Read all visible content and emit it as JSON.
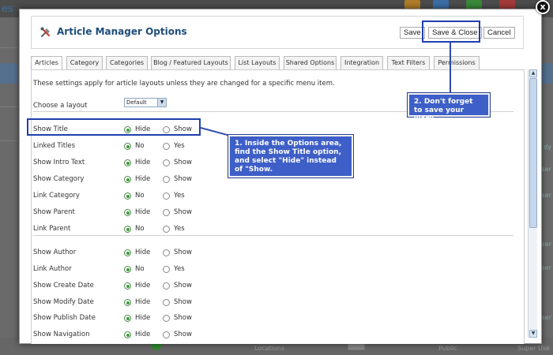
{
  "background": {
    "partial_word": "es",
    "right_text": [
      "dy",
      "ser",
      "ser",
      "ser",
      "ser",
      "ser"
    ],
    "bottom_texts": [
      "Locations",
      "0",
      "Public",
      "Super Use"
    ]
  },
  "modal": {
    "title": "Article Manager Options",
    "close_glyph": "x",
    "toolbar": {
      "save_label": "Save",
      "save_close_label": "Save & Close",
      "cancel_label": "Cancel"
    },
    "tabs": [
      {
        "label": "Articles",
        "active": true
      },
      {
        "label": "Category",
        "active": false
      },
      {
        "label": "Categories",
        "active": false
      },
      {
        "label": "Blog / Featured Layouts",
        "active": false
      },
      {
        "label": "List Layouts",
        "active": false
      },
      {
        "label": "Shared Options",
        "active": false
      },
      {
        "label": "Integration",
        "active": false
      },
      {
        "label": "Text Filters",
        "active": false
      },
      {
        "label": "Permissions",
        "active": false
      }
    ],
    "intro_text": "These settings apply for article layouts unless they are changed for a specific menu item.",
    "layout": {
      "label": "Choose a layout",
      "selected": "Default"
    },
    "options": [
      {
        "label": "Show Title",
        "choices": [
          "Hide",
          "Show"
        ],
        "selected": 0
      },
      {
        "label": "Linked Titles",
        "choices": [
          "No",
          "Yes"
        ],
        "selected": 0
      },
      {
        "label": "Show Intro Text",
        "choices": [
          "Hide",
          "Show"
        ],
        "selected": 0
      },
      {
        "label": "Show Category",
        "choices": [
          "Hide",
          "Show"
        ],
        "selected": 0
      },
      {
        "label": "Link Category",
        "choices": [
          "No",
          "Yes"
        ],
        "selected": 0
      },
      {
        "label": "Show Parent",
        "choices": [
          "Hide",
          "Show"
        ],
        "selected": 0
      },
      {
        "label": "Link Parent",
        "choices": [
          "No",
          "Yes"
        ],
        "selected": 0
      },
      {
        "label": "Show Author",
        "choices": [
          "Hide",
          "Show"
        ],
        "selected": 0
      },
      {
        "label": "Link Author",
        "choices": [
          "No",
          "Yes"
        ],
        "selected": 0
      },
      {
        "label": "Show Create Date",
        "choices": [
          "Hide",
          "Show"
        ],
        "selected": 0
      },
      {
        "label": "Show Modify Date",
        "choices": [
          "Hide",
          "Show"
        ],
        "selected": 0
      },
      {
        "label": "Show Publish Date",
        "choices": [
          "Hide",
          "Show"
        ],
        "selected": 0
      },
      {
        "label": "Show Navigation",
        "choices": [
          "Hide",
          "Show"
        ],
        "selected": 0
      }
    ]
  },
  "callouts": {
    "step1": "1. Inside the Options area, find the Show Title option, and select \"Hide\" instead of \"Show.",
    "step2": "2. Don't forget to save your work."
  },
  "colors": {
    "callout_bg": "#3e5fc7",
    "highlight_border": "#1f3fae",
    "title_color": "#1e4d79",
    "radio_checked": "#3a9a3a"
  }
}
